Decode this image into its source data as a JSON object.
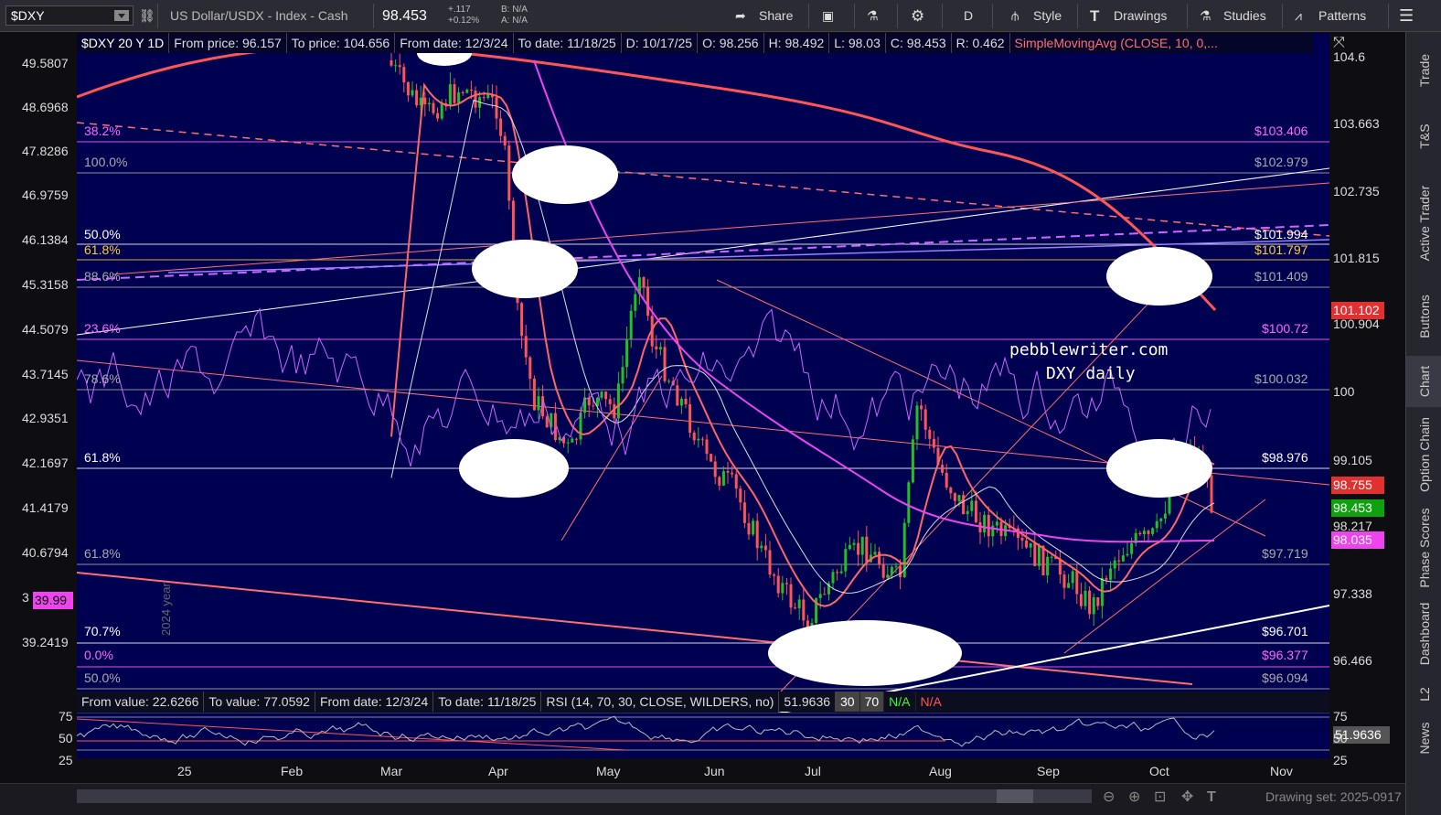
{
  "toolbar": {
    "symbol": "$DXY",
    "symbol_name": "US Dollar/USDX - Index - Cash",
    "last_price": "98.453",
    "change": "+.117",
    "change_pct": "+0.12%",
    "bid": "B: N/A",
    "ask": "A: N/A",
    "share": "Share",
    "interval": "D",
    "style": "Style",
    "drawings": "Drawings",
    "studies": "Studies",
    "patterns": "Patterns"
  },
  "info_bar": {
    "symbol": "$DXY 20 Y 1D",
    "from_price": "From price: 96.157",
    "to_price": "To price: 104.656",
    "from_date": "From date: 12/3/24",
    "to_date": "To date: 11/18/25",
    "date": "D: 10/17/25",
    "open": "O: 98.256",
    "high": "H: 98.492",
    "low": "L: 98.03",
    "close": "C: 98.453",
    "ratio": "R: 0.462",
    "study": "SimpleMovingAvg (CLOSE, 10, 0,..."
  },
  "rsi_bar": {
    "from_value": "From value: 22.6266",
    "to_value": "To value: 77.0592",
    "from_date": "From date: 12/3/24",
    "to_date": "To date: 11/18/25",
    "study": "RSI (14, 70, 30, CLOSE, WILDERS, no)",
    "value": "51.9636",
    "b30": "30",
    "b70": "70",
    "na1": "N/A",
    "na2": "N/A"
  },
  "left_axis": [
    "49.5807",
    "48.6968",
    "47.8286",
    "46.9759",
    "46.1384",
    "45.3158",
    "44.5079",
    "43.7145",
    "42.9351",
    "42.1697",
    "41.4179",
    "40.6794",
    "3",
    "39.2419"
  ],
  "left_tag": "39.99",
  "right_axis": [
    "104.6",
    "103.663",
    "102.735",
    "101.815",
    "100.904",
    "100",
    "99.105",
    "98.217",
    "97.338",
    "96.466"
  ],
  "fib_left": [
    {
      "text": "38.2%",
      "color": "#ff66ff"
    },
    {
      "text": "100.0%",
      "color": "#aaaaaa"
    },
    {
      "text": "50.0%",
      "color": "#ffffff"
    },
    {
      "text": "61.8%",
      "color": "#ffcc33"
    },
    {
      "text": "88.6%",
      "color": "#aaaaaa"
    },
    {
      "text": "23.6%",
      "color": "#ff66ff"
    },
    {
      "text": "78.6%",
      "color": "#aaaaaa"
    },
    {
      "text": "61.8%",
      "color": "#ffffff"
    },
    {
      "text": "61.8%",
      "color": "#aaaaaa"
    },
    {
      "text": "70.7%",
      "color": "#ffffff"
    },
    {
      "text": "0.0%",
      "color": "#ff66ff"
    },
    {
      "text": "50.0%",
      "color": "#aaaaaa"
    }
  ],
  "fib_right": [
    {
      "text": "$103.406",
      "color": "#ff66ff"
    },
    {
      "text": "$102.979",
      "color": "#aaaaaa"
    },
    {
      "text": "$101.994",
      "color": "#ffffff"
    },
    {
      "text": "$101.797",
      "color": "#ffcc33"
    },
    {
      "text": "$101.409",
      "color": "#aaaaaa"
    },
    {
      "text": "$100.72",
      "color": "#ff66ff"
    },
    {
      "text": "$100.032",
      "color": "#aaaaaa"
    },
    {
      "text": "$98.976",
      "color": "#ffffff"
    },
    {
      "text": "$97.719",
      "color": "#aaaaaa"
    },
    {
      "text": "$96.701",
      "color": "#ffffff"
    },
    {
      "text": "$96.377",
      "color": "#ff66ff"
    },
    {
      "text": "$96.094",
      "color": "#aaaaaa"
    }
  ],
  "price_tags": [
    {
      "text": "101.102",
      "color": "#e03030"
    },
    {
      "text": "98.755",
      "color": "#e03030"
    },
    {
      "text": "98.453",
      "color": "#10a010"
    },
    {
      "text": "98.035",
      "color": "#ee44ee"
    }
  ],
  "rsi_axis": [
    "75",
    "50",
    "25"
  ],
  "rsi_tag": "51.9636",
  "x_labels": [
    "25",
    "Feb",
    "Mar",
    "Apr",
    "May",
    "Jun",
    "Jul",
    "Aug",
    "Sep",
    "Oct",
    "Nov"
  ],
  "year_marker": "2024 year",
  "watermark_line1": "pebblewriter.com",
  "watermark_line2": "DXY daily",
  "drawing_set": "Drawing set: 2025-0917",
  "sidebar_tabs": [
    "Trade",
    "T&S",
    "Active Trader",
    "Buttons",
    "Chart",
    "Option Chain",
    "Phase Scores",
    "Dashboard",
    "L2",
    "News"
  ],
  "active_tab": "Chart",
  "colors": {
    "panel_bg": "#000050",
    "candle_up": "#22c022",
    "candle_down": "#ff5555",
    "sma_fast": "#ff6666",
    "sma_white": "#dddddd",
    "sma_magenta": "#ee44ee",
    "rsi_line": "#cc66ff"
  }
}
